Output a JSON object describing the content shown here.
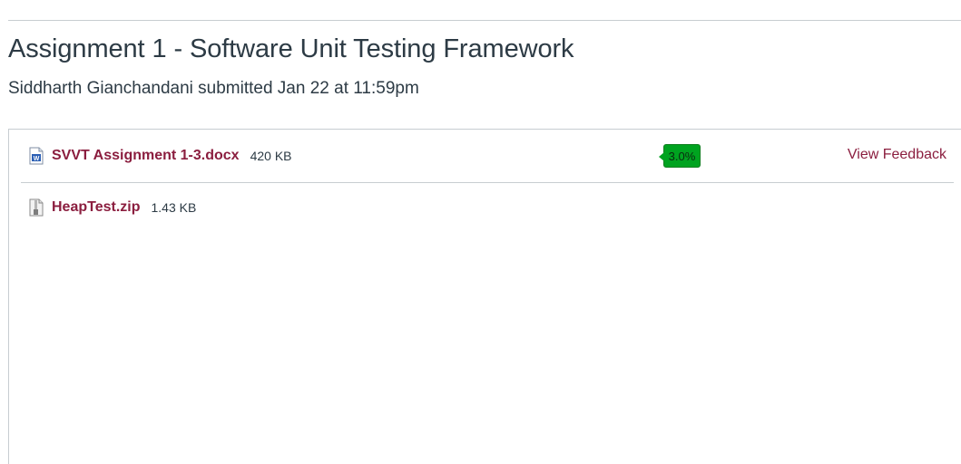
{
  "page": {
    "title": "Assignment 1 - Software Unit Testing Framework",
    "submitted_line": "Siddharth Gianchandani submitted Jan 22 at 11:59pm"
  },
  "files": [
    {
      "name": "SVVT Assignment 1-3.docx",
      "size": "420 KB",
      "icon": "word-document-icon",
      "score": "3.0%",
      "score_color": "#00a320",
      "feedback_label": "View Feedback"
    },
    {
      "name": "HeapTest.zip",
      "size": "1.43 KB",
      "icon": "zip-file-icon"
    }
  ],
  "colors": {
    "link": "#8b1e3f",
    "text": "#2d3b45",
    "divider": "#c7cdd1"
  }
}
